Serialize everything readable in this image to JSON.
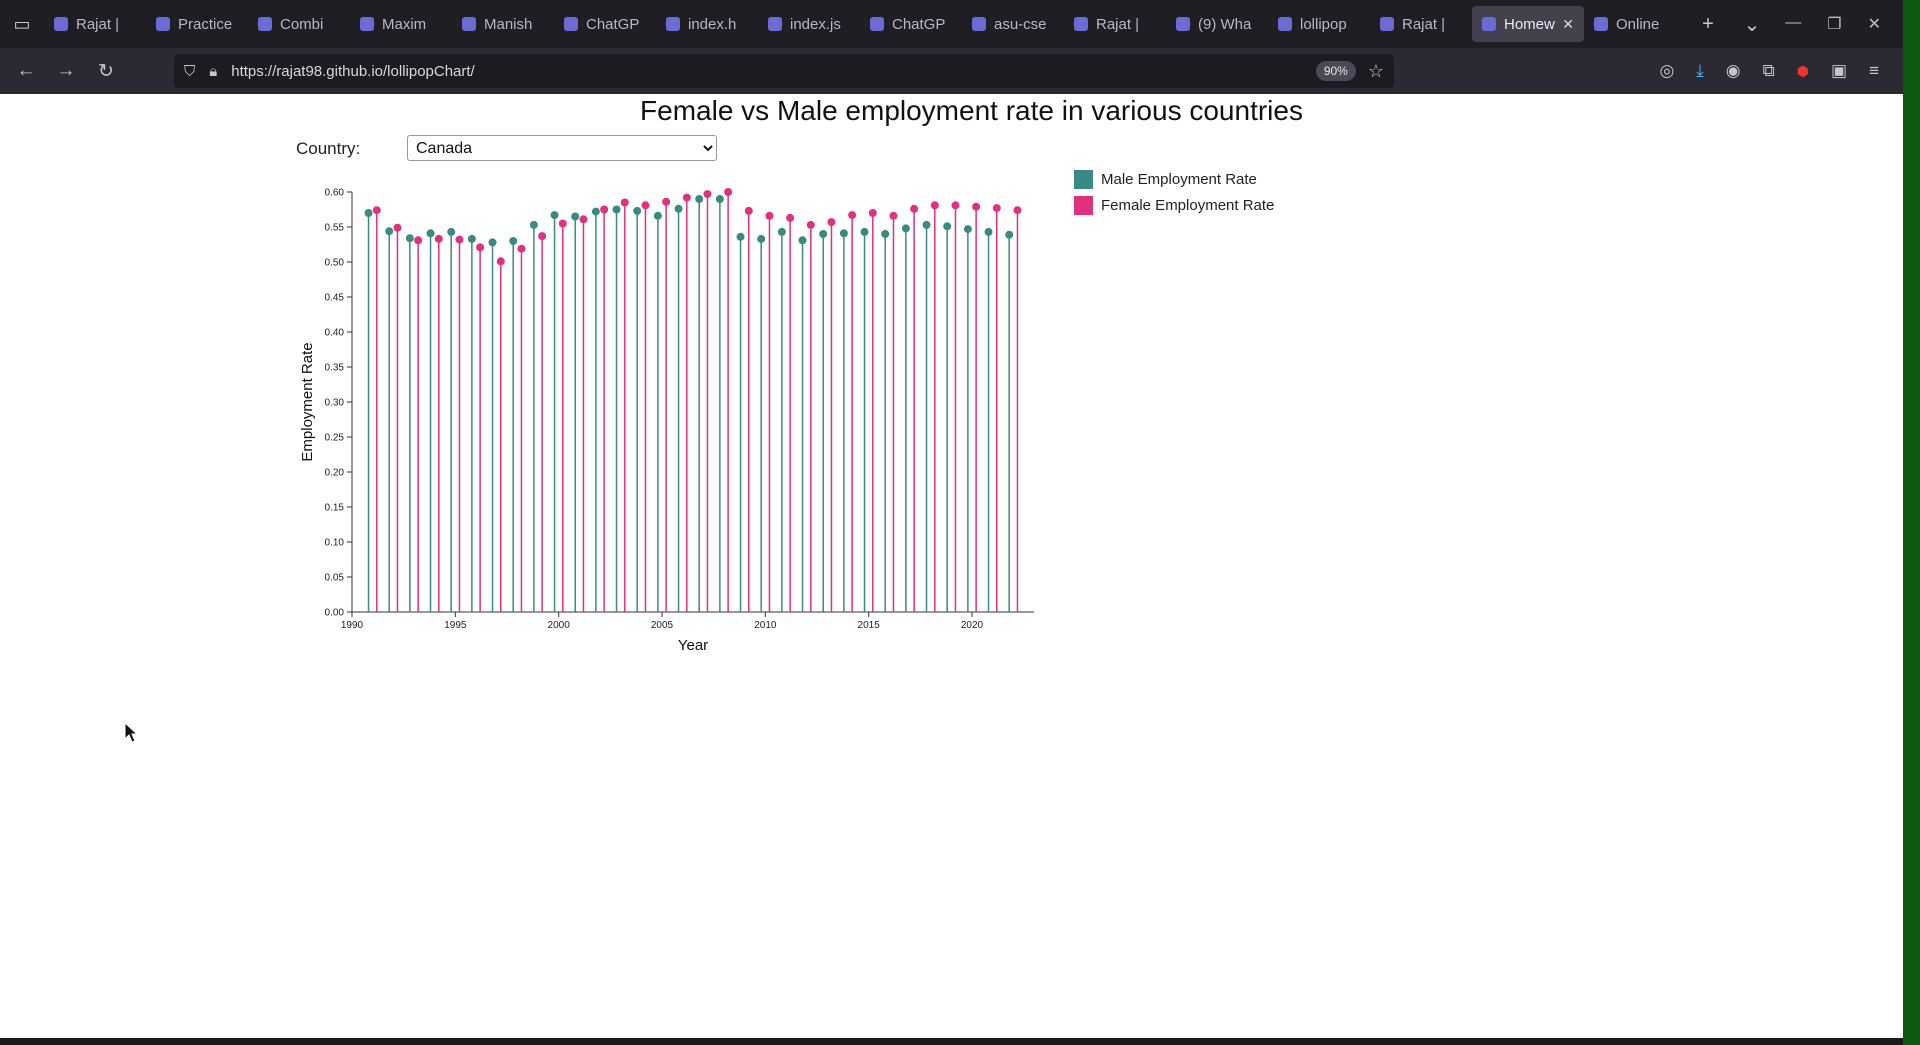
{
  "browser": {
    "tabs": [
      {
        "label": "Rajat |"
      },
      {
        "label": "Practice"
      },
      {
        "label": "Combi"
      },
      {
        "label": "Maxim"
      },
      {
        "label": "Manish"
      },
      {
        "label": "ChatGP"
      },
      {
        "label": "index.h"
      },
      {
        "label": "index.js"
      },
      {
        "label": "ChatGP"
      },
      {
        "label": "asu-cse"
      },
      {
        "label": "Rajat |"
      },
      {
        "label": "(9) Wha"
      },
      {
        "label": "lollipop"
      },
      {
        "label": "Rajat |"
      },
      {
        "label": "Homew"
      },
      {
        "label": "Online"
      }
    ],
    "active_tab_index": 14,
    "url": "https://rajat98.github.io/lollipopChart/",
    "zoom": "90%"
  },
  "page": {
    "title": "Female vs Male employment rate in various countries",
    "country_label": "Country:",
    "country_selected": "Canada"
  },
  "chart_data": {
    "type": "lollipop",
    "title": "Female vs Male employment rate in various countries",
    "xlabel": "Year",
    "ylabel": "Employment Rate",
    "xlim": [
      1990,
      2023
    ],
    "ylim": [
      0,
      0.6
    ],
    "x_ticks": [
      "1990",
      "1995",
      "2000",
      "2005",
      "2010",
      "2015",
      "2020"
    ],
    "y_ticks": [
      "0.00",
      "0.05",
      "0.10",
      "0.15",
      "0.20",
      "0.25",
      "0.30",
      "0.35",
      "0.40",
      "0.45",
      "0.50",
      "0.55",
      "0.60"
    ],
    "legend_position": "top-right",
    "x": [
      1991,
      1992,
      1993,
      1994,
      1995,
      1996,
      1997,
      1998,
      1999,
      2000,
      2001,
      2002,
      2003,
      2004,
      2005,
      2006,
      2007,
      2008,
      2009,
      2010,
      2011,
      2012,
      2013,
      2014,
      2015,
      2016,
      2017,
      2018,
      2019,
      2020,
      2021,
      2022
    ],
    "series": [
      {
        "name": "Male Employment Rate",
        "color": "#3a8a83",
        "values": [
          0.57,
          0.544,
          0.534,
          0.541,
          0.543,
          0.533,
          0.528,
          0.53,
          0.553,
          0.567,
          0.565,
          0.572,
          0.575,
          0.573,
          0.566,
          0.576,
          0.59,
          0.59,
          0.536,
          0.533,
          0.543,
          0.531,
          0.54,
          0.541,
          0.543,
          0.54,
          0.548,
          0.553,
          0.551,
          0.547,
          0.543,
          0.539
        ]
      },
      {
        "name": "Female Employment Rate",
        "color": "#e0307f",
        "values": [
          0.574,
          0.549,
          0.531,
          0.533,
          0.532,
          0.521,
          0.501,
          0.519,
          0.537,
          0.555,
          0.561,
          0.575,
          0.585,
          0.581,
          0.586,
          0.592,
          0.597,
          0.6,
          0.573,
          0.566,
          0.563,
          0.553,
          0.557,
          0.567,
          0.57,
          0.566,
          0.576,
          0.581,
          0.581,
          0.579,
          0.577,
          0.574
        ]
      }
    ]
  }
}
